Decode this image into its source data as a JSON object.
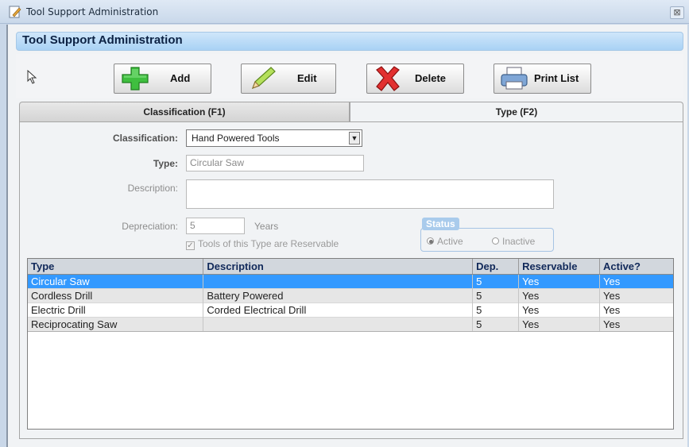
{
  "window": {
    "title": "Tool Support Administration",
    "close_glyph": "⊠"
  },
  "header": {
    "title": "Tool Support Administration"
  },
  "toolbar": {
    "add_label": "Add",
    "edit_label": "Edit",
    "delete_label": "Delete",
    "print_label": "Print List"
  },
  "tabs": [
    {
      "label": "Classification (F1)"
    },
    {
      "label": "Type (F2)"
    }
  ],
  "form": {
    "classification_label": "Classification:",
    "classification_value": "Hand Powered Tools",
    "type_label": "Type:",
    "type_value": "Circular Saw",
    "description_label": "Description:",
    "description_value": "",
    "depreciation_label": "Depreciation:",
    "depreciation_value": "5",
    "depreciation_unit": "Years",
    "reservable_label": "Tools of this Type are Reservable",
    "status_title": "Status",
    "status_active_label": "Active",
    "status_inactive_label": "Inactive"
  },
  "grid": {
    "columns": [
      "Type",
      "Description",
      "Dep.",
      "Reservable",
      "Active?"
    ],
    "rows": [
      [
        "Circular Saw",
        "",
        "5",
        "Yes",
        "Yes"
      ],
      [
        "Cordless Drill",
        "Battery Powered",
        "5",
        "Yes",
        "Yes"
      ],
      [
        "Electric Drill",
        "Corded Electrical Drill",
        "5",
        "Yes",
        "Yes"
      ],
      [
        "Reciprocating Saw",
        "",
        "5",
        "Yes",
        "Yes"
      ]
    ]
  },
  "colors": {
    "selection": "#3399ff",
    "header_band": "#a9d2f5",
    "grid_header_text": "#11295a"
  }
}
